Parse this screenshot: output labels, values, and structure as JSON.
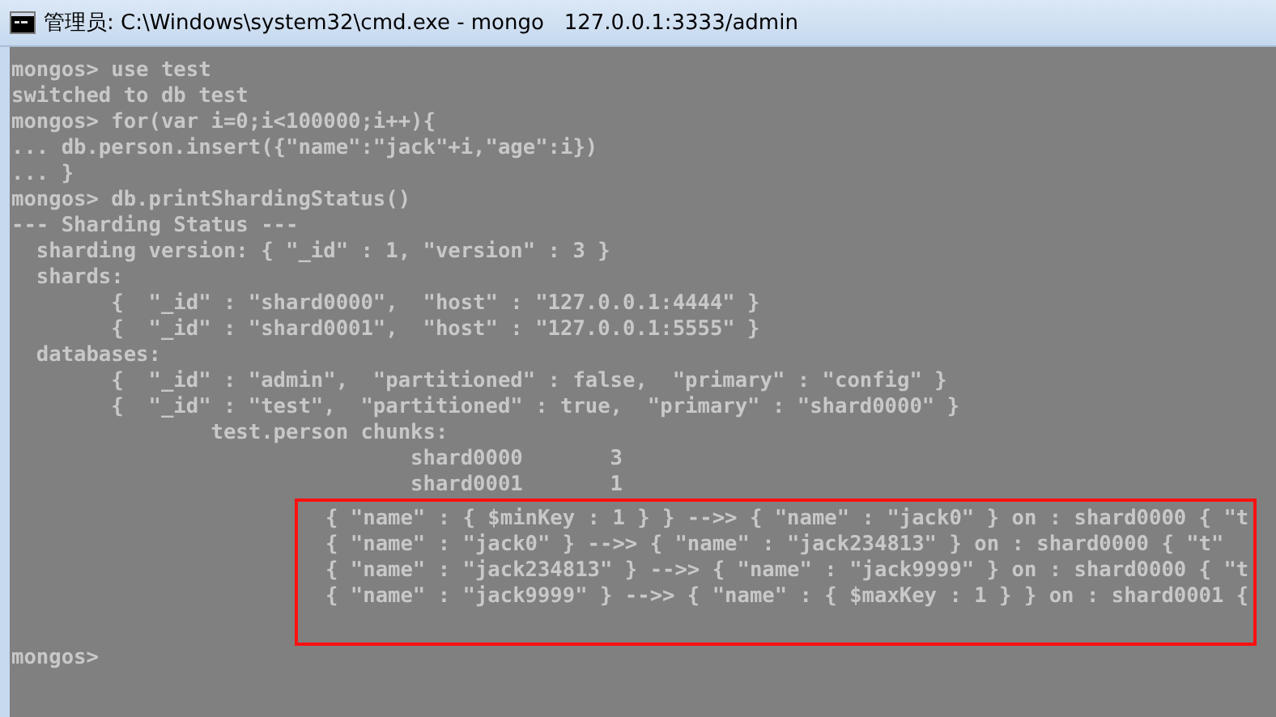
{
  "window": {
    "title": "管理员: C:\\Windows\\system32\\cmd.exe - mongo   127.0.0.1:3333/admin"
  },
  "console": {
    "lines": [
      "mongos> use test",
      "switched to db test",
      "mongos> for(var i=0;i<100000;i++){",
      "... db.person.insert({\"name\":\"jack\"+i,\"age\":i})",
      "... }",
      "mongos> db.printShardingStatus()",
      "--- Sharding Status ---",
      "  sharding version: { \"_id\" : 1, \"version\" : 3 }",
      "  shards:",
      "        {  \"_id\" : \"shard0000\",  \"host\" : \"127.0.0.1:4444\" }",
      "        {  \"_id\" : \"shard0001\",  \"host\" : \"127.0.0.1:5555\" }",
      "  databases:",
      "        {  \"_id\" : \"admin\",  \"partitioned\" : false,  \"primary\" : \"config\" }",
      "        {  \"_id\" : \"test\",  \"partitioned\" : true,  \"primary\" : \"shard0000\" }",
      "                test.person chunks:",
      "                                shard0000       3",
      "                                shard0001       1"
    ],
    "highlighted_lines": [
      "{ \"name\" : { $minKey : 1 } } -->> { \"name\" : \"jack0\" } on : shard0000 { \"t",
      "{ \"name\" : \"jack0\" } -->> { \"name\" : \"jack234813\" } on : shard0000 { \"t\"",
      "{ \"name\" : \"jack234813\" } -->> { \"name\" : \"jack9999\" } on : shard0000 { \"t",
      "{ \"name\" : \"jack9999\" } -->> { \"name\" : { $maxKey : 1 } } on : shard0001 {"
    ],
    "prompt": "mongos>"
  }
}
